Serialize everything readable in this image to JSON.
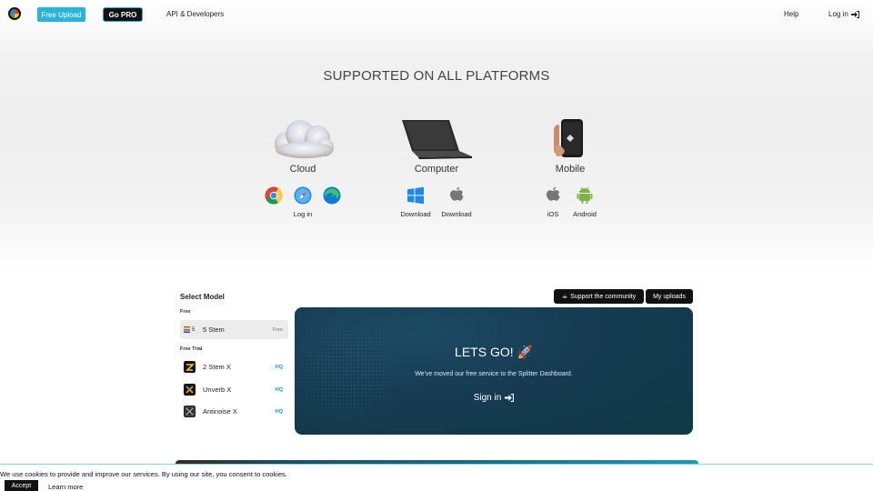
{
  "header": {
    "free_upload": "Free Upload",
    "go_pro": "Go PRO",
    "api": "API & Developers",
    "help": "Help",
    "login": "Log in"
  },
  "platforms": {
    "title": "SUPPORTED ON ALL PLATFORMS",
    "cloud": {
      "name": "Cloud",
      "link": "Log in",
      "icons": [
        "chrome-icon",
        "safari-icon",
        "edge-icon"
      ]
    },
    "computer": {
      "name": "Computer",
      "windows_label": "Download",
      "mac_label": "Download"
    },
    "mobile": {
      "name": "Mobile",
      "ios_label": "iOS",
      "android_label": "Android"
    }
  },
  "models": {
    "title": "Select Model",
    "free_label": "Free",
    "trial_label": "Free Trial",
    "free_items": [
      {
        "name": "5 Stem",
        "prefix": "5",
        "tag": "Free"
      }
    ],
    "trial_items": [
      {
        "name": "2 Stem X",
        "tag": "HQ"
      },
      {
        "name": "Unverb X",
        "tag": "HQ"
      },
      {
        "name": "Antinoise X",
        "tag": "HQ"
      }
    ]
  },
  "actions": {
    "support": "Support the community",
    "support_icon": "☕",
    "uploads": "My uploads"
  },
  "card": {
    "title": "LETS GO! 🚀",
    "subtitle": "We've moved our free service to the Splitter Dashboard.",
    "sign_in": "Sign in"
  },
  "cookie": {
    "text": "We use cookies to provide and improve our services. By using our site, you consent to cookies.",
    "accept": "Accept",
    "learn_more": "Learn more"
  },
  "colors": {
    "accent": "#2bb3d9",
    "hq": "#1d8fc9",
    "card_bg": "#163b52"
  }
}
